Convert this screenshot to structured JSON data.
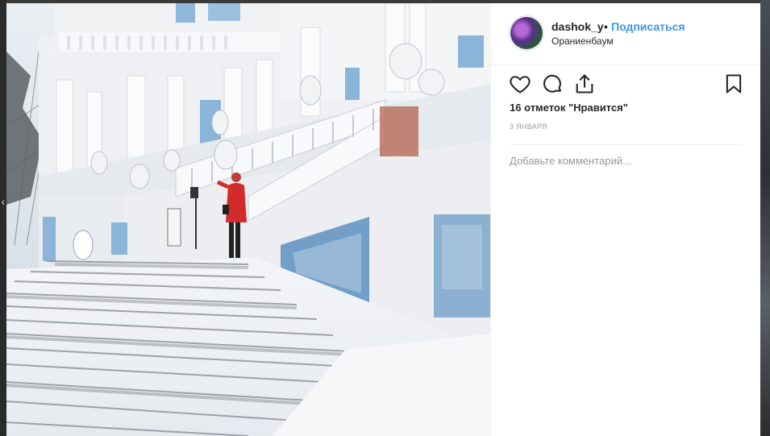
{
  "post": {
    "username": "dashok_y",
    "separator": "•",
    "follow_label": "Подписаться",
    "location": "Ораниенбаум",
    "likes": "16 отметок \"Нравится\"",
    "date": "3 января",
    "comment_placeholder": "Добавьте комментарий..."
  },
  "icons": {
    "like": "heart-icon",
    "comment": "comment-bubble-icon",
    "share": "share-icon",
    "save": "bookmark-icon",
    "nav": "chevron-left-icon"
  },
  "colors": {
    "link": "#3897f0",
    "text": "#262626",
    "muted": "#999999"
  }
}
